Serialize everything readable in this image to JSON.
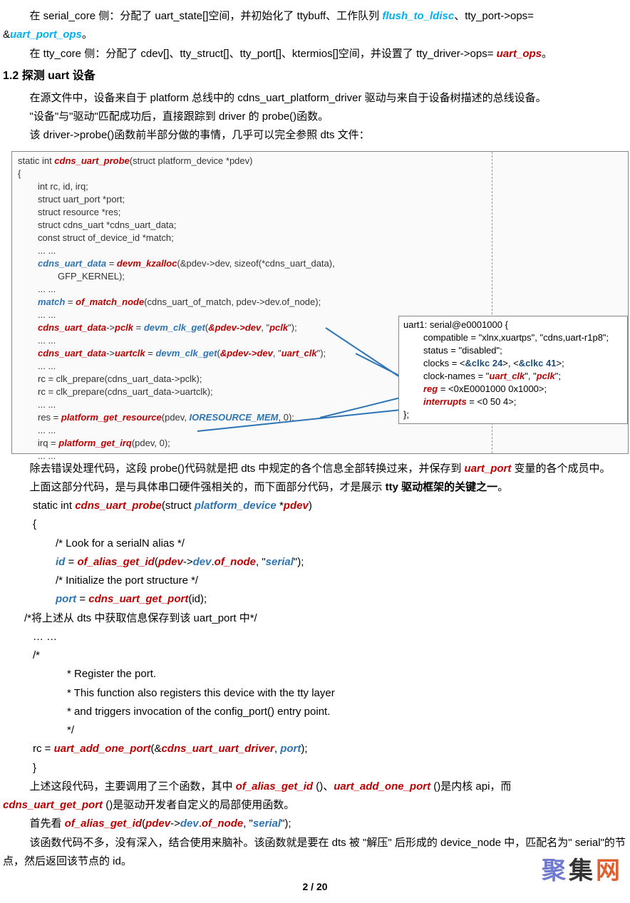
{
  "p1_a": "在 serial_core 侧：分配了 uart_state[]空间，并初始化了 ttybuff、工作队列 ",
  "p1_teal": "flush_to_ldisc",
  "p1_b": "、tty_port->ops= ",
  "p1_amp": "&",
  "p1_teal2": "uart_port_ops",
  "p1_c": "。",
  "p2_a": "在 tty_core 侧：分配了 cdev[]、tty_struct[]、tty_port[]、ktermios[]空间，并设置了 tty_driver->ops= ",
  "p2_red": "uart_ops",
  "p2_b": "。",
  "h1": "1.2 探测 uart 设备",
  "p3": "在源文件中，设备来自于 platform 总线中的 cdns_uart_platform_driver 驱动与来自于设备树描述的总线设备。",
  "p4": "\"设备\"与\"驱动\"匹配成功后，直接跟踪到 driver 的 probe()函数。",
  "p5": "该 driver->probe()函数前半部分做的事情，几乎可以完全参照 dts 文件：",
  "c01a": "static int ",
  "c01r": "cdns_uart_probe",
  "c01b": "(struct platform_device *pdev)",
  "c02": "{",
  "c03": "int rc, id, irq;",
  "c04": "struct uart_port *port;",
  "c05": "struct resource *res;",
  "c06": "struct cdns_uart *cdns_uart_data;",
  "c07": "const struct of_device_id *match;",
  "c08": "...  ...",
  "c09b": "cdns_uart_data",
  "c09a": " = ",
  "c09r": "devm_kzalloc",
  "c09c": "(&pdev->dev, sizeof(*cdns_uart_data),",
  "c10": "GFP_KERNEL);",
  "c11": "...  ...",
  "c12b": "match",
  "c12a": " = ",
  "c12r": "of_match_node",
  "c12c": "(cdns_uart_of_match, pdev->dev.of_node);",
  "c13": "...  ...",
  "c14r1": "cdns_uart_data",
  "c14a": "->",
  "c14r2": "pclk",
  "c14b": " = ",
  "c14bl": "devm_clk_get",
  "c14c": "(",
  "c14r3": "&pdev->dev",
  "c14d": ", \"",
  "c14r4": "pclk",
  "c14e": "\");",
  "c15": "...  ...",
  "c16r1": "cdns_uart_data",
  "c16a": "->",
  "c16r2": "uartclk",
  "c16b": " = ",
  "c16bl": "devm_clk_get",
  "c16c": "(",
  "c16r3": "&pdev->dev",
  "c16d": ", \"",
  "c16r4": "uart_clk",
  "c16e": "\");",
  "c17": "...  ...",
  "c18": "rc = clk_prepare(cdns_uart_data->pclk);",
  "c19": "rc = clk_prepare(cdns_uart_data->uartclk);",
  "c20": "...  ...",
  "c21a": "res = ",
  "c21r": "platform_get_resource",
  "c21b": "(pdev, ",
  "c21bl": "IORESOURCE_MEM",
  "c21c": ", 0);",
  "c22": "...  ...",
  "c23a": "irq = ",
  "c23r": "platform_get_irq",
  "c23b": "(pdev, 0);",
  "c24": "...  ...",
  "d1": "uart1: serial@e0001000 {",
  "d2a": "compatible = \"xlnx,xuartps\", \"cdns,uart-r1p8\";",
  "d3a": "status = \"disabled\";",
  "d4a": "clocks = <",
  "d4b": "&clkc 24",
  "d4c": ">, <",
  "d4d": "&clkc 41",
  "d4e": ">;",
  "d5a": "clock-names = \"",
  "d5b": "uart_clk",
  "d5c": "\", \"",
  "d5d": "pclk",
  "d5e": "\";",
  "d6a": "reg",
  "d6b": " = <0xE0001000 0x1000>;",
  "d7a": "interrupts",
  "d7b": " = <0 50 4>;",
  "d8": "};",
  "p6a": "除去错误处理代码，这段 probe()代码就是把 dts 中规定的各个信息全部转换过来，并保存到 ",
  "p6r": "uart_port",
  "p6b": " 变量的各个成员中。",
  "p7a": "上面这部分代码，是与具体串口硬件强相关的，而下面部分代码，才是展示 ",
  "p7b": "tty 驱动框架的关键之一",
  "p7c": "。",
  "s1a": "static int ",
  "s1r": "cdns_uart_probe",
  "s1b": "(struct ",
  "s1bl": "platform_device",
  "s1c": " *",
  "s1r2": "pdev",
  "s1d": ")",
  "s2": "{",
  "s3": "/* Look for a serialN alias */",
  "s4bl": "id",
  "s4a": " = ",
  "s4r": "of_alias_get_id",
  "s4b": "(",
  "s4r2": "pdev",
  "s4c": "->",
  "s4bl2": "dev",
  "s4d": ".",
  "s4r3": "of_node",
  "s4e": ", \"",
  "s4bl3": "serial",
  "s4f": "\");",
  "s5": "/* Initialize the port structure */",
  "s6bl": "port",
  "s6a": " = ",
  "s6r": "cdns_uart_get_port",
  "s6b": "(id);",
  "s7": "/*将上述从 dts 中获取信息保存到该 uart_port 中*/",
  "s8": "… …",
  "s9": "/*",
  "s10": "* Register the port.",
  "s11": "* This function also registers this device with the tty layer",
  "s12": "* and triggers invocation of the config_port() entry point.",
  "s13": "*/",
  "s14a": "rc = ",
  "s14r": "uart_add_one_port",
  "s14b": "(&",
  "s14r2": "cdns_uart_uart_driver",
  "s14c": ", ",
  "s14bl": "port",
  "s14d": ");",
  "s15": "}",
  "p8a": "上述这段代码，主要调用了三个函数，其中 ",
  "p8r1": "of_alias_get_id",
  "p8b": " ()、",
  "p8r2": "uart_add_one_port",
  "p8c": " ()是内核 api，而 ",
  "p8r3": "cdns_uart_get_port",
  "p8d": " ()是驱动开发者自定义的局部使用函数。",
  "p9a": "首先看 ",
  "p9r": "of_alias_get_id",
  "p9b": "(",
  "p9r2": "pdev",
  "p9c": "->",
  "p9bl": "dev",
  "p9d": ".",
  "p9r3": "of_node",
  "p9e": ", \"",
  "p9bl2": "serial",
  "p9f": "\");",
  "p10": "该函数代码不多，没有深入，结合使用来脑补。该函数就是要在 dts 被 \"解压\" 后形成的 device_node 中，匹配名为\" serial\"的节点，然后返回该节点的 id。",
  "foot": "2 / 20",
  "wm": "聚集网"
}
